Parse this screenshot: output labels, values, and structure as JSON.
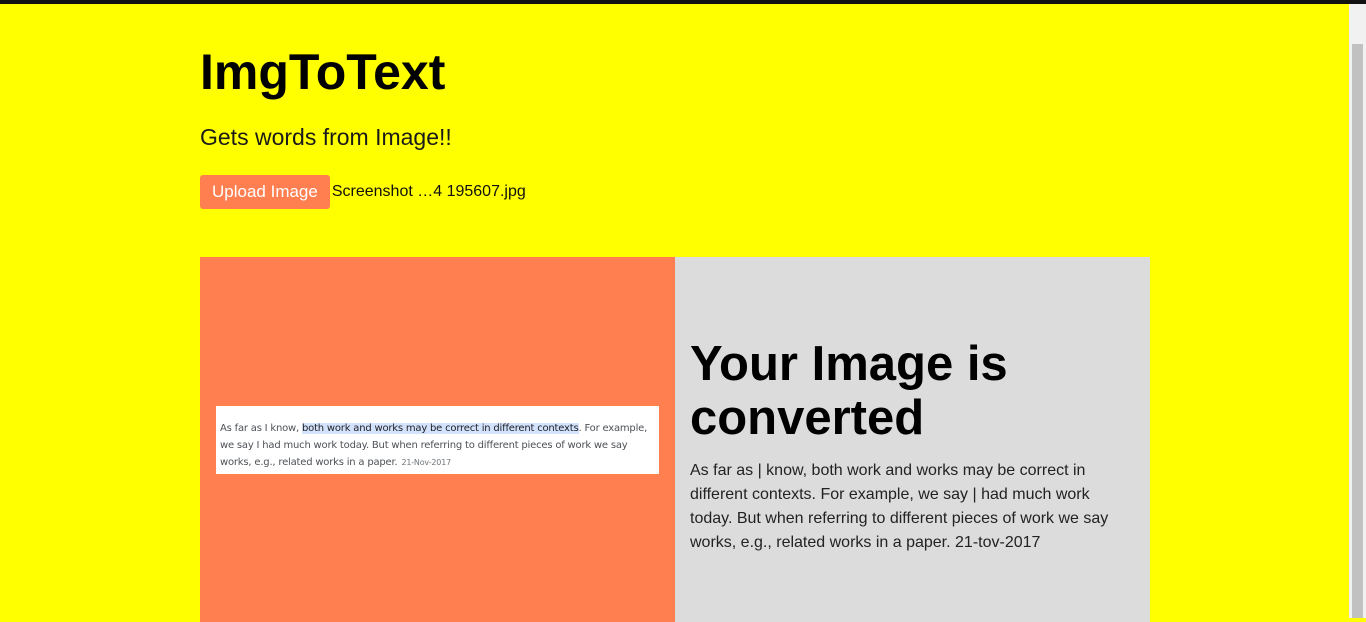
{
  "app": {
    "title": "ImgToText",
    "subtitle": "Gets words from Image!!"
  },
  "upload": {
    "button_label": "Upload Image",
    "file_name": "Screenshot …4 195607.jpg"
  },
  "preview": {
    "text_before": "As far as I know, ",
    "text_highlight": "both work and works may be correct in different contexts",
    "text_after": ". For example, we say I had much work today. But when referring to different pieces of work we say works, e.g., related works in a paper.",
    "date": "21-Nov-2017"
  },
  "result": {
    "title": "Your Image is converted",
    "text": "As far as | know, both work and works may be correct in different contexts. For example, we say | had much work today. But when referring to different pieces of work we say works, e.g., related works in a paper. 21-tov-2017"
  },
  "colors": {
    "page_background": "#ffff00",
    "accent": "#ff7f50",
    "result_background": "#dcdcdc"
  }
}
